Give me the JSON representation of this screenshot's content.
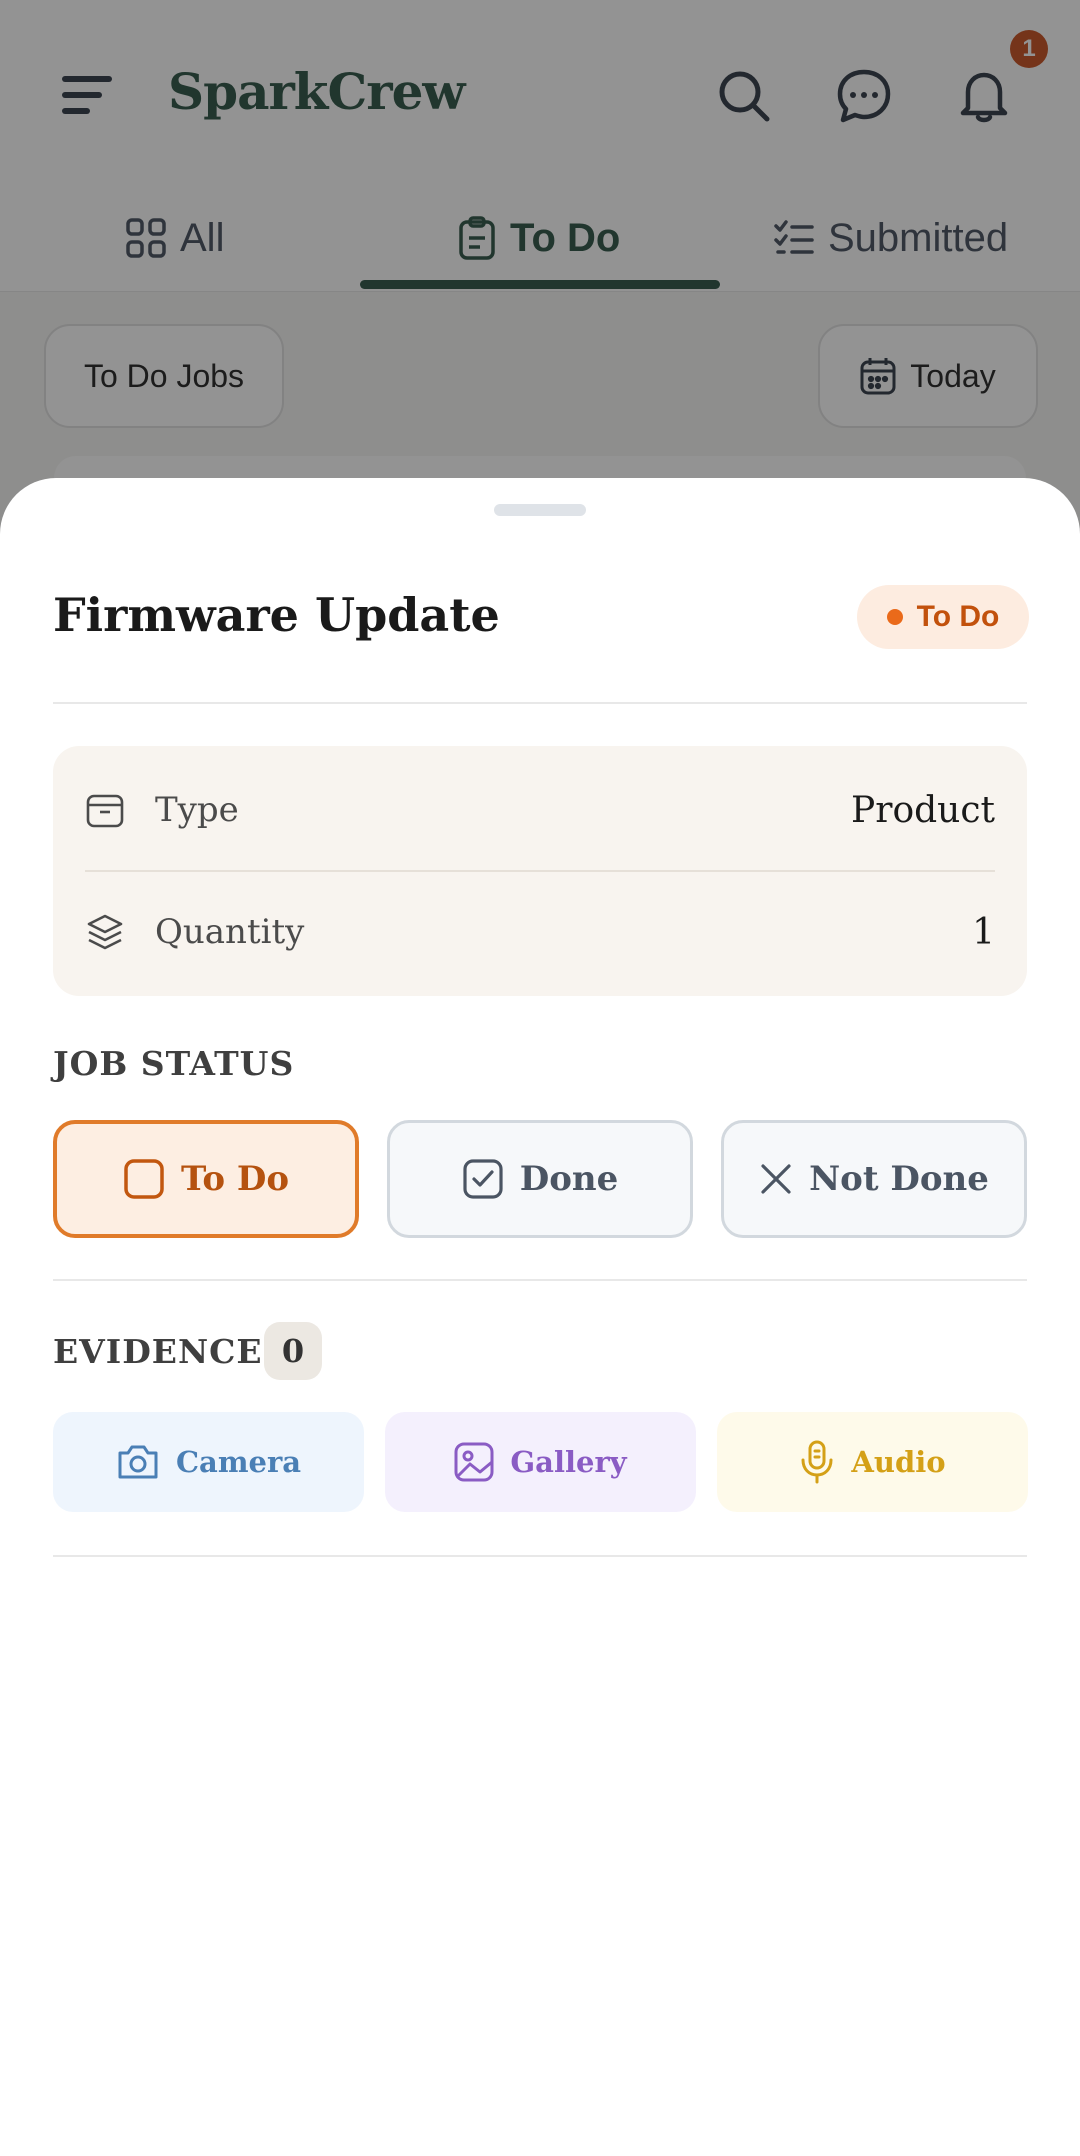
{
  "app": {
    "brand": "SparkCrew",
    "notification_count": "1"
  },
  "tabs": [
    {
      "label": "All",
      "icon": "grid-icon"
    },
    {
      "label": "To Do",
      "icon": "clipboard-icon",
      "active": true
    },
    {
      "label": "Submitted",
      "icon": "checklist-icon"
    }
  ],
  "filters": {
    "left_label": "To Do Jobs",
    "date_label": "Today"
  },
  "sheet": {
    "title": "Firmware Update",
    "status_badge": "To Do",
    "info": [
      {
        "icon": "box-icon",
        "label": "Type",
        "value": "Product"
      },
      {
        "icon": "layers-icon",
        "label": "Quantity",
        "value": "1"
      }
    ],
    "job_status": {
      "label": "JOB STATUS",
      "options": [
        {
          "label": "To Do",
          "icon": "square-icon",
          "selected": true
        },
        {
          "label": "Done",
          "icon": "check-square-icon",
          "selected": false
        },
        {
          "label": "Not Done",
          "icon": "x-icon",
          "selected": false
        }
      ]
    },
    "evidence": {
      "label": "EVIDENCE",
      "count": "0",
      "buttons": [
        {
          "label": "Camera",
          "icon": "camera-icon",
          "color": "#4a7fb5",
          "bg": "#eef5fd"
        },
        {
          "label": "Gallery",
          "icon": "image-icon",
          "color": "#8a5cc4",
          "bg": "#f4f0fd"
        },
        {
          "label": "Audio",
          "icon": "microphone-icon",
          "color": "#d4a017",
          "bg": "#fefaea"
        }
      ]
    }
  },
  "colors": {
    "brand": "#1b4535",
    "accent_orange": "#e07b2a",
    "notif_badge": "#c2410c"
  }
}
